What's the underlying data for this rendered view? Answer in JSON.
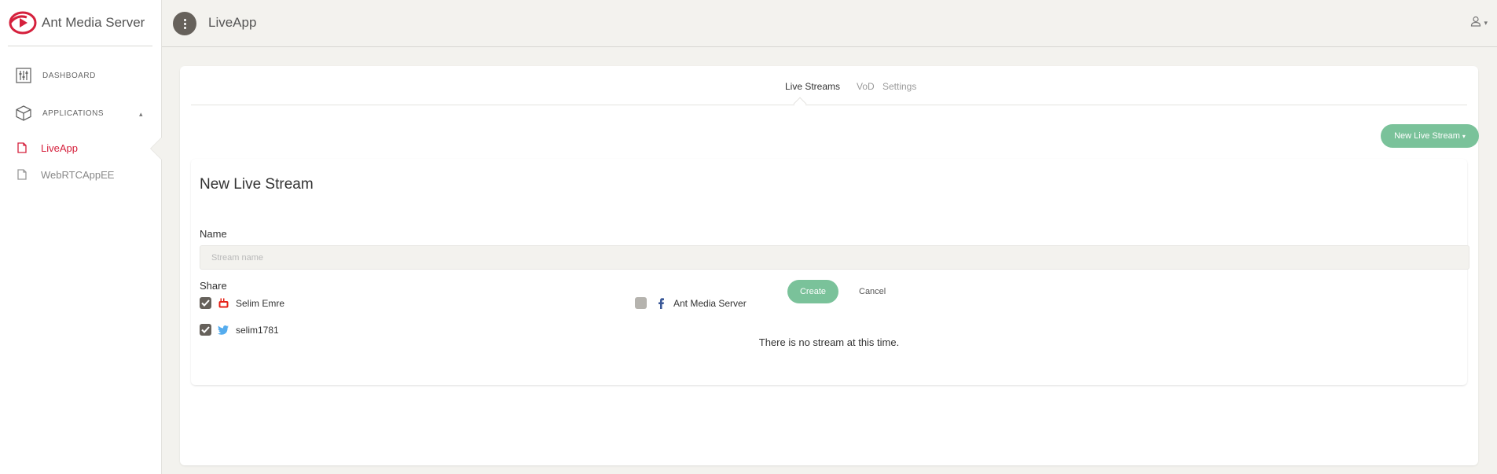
{
  "brand": {
    "name": "Ant Media Server",
    "accent": "#d5203c"
  },
  "sidebar": {
    "nav": [
      {
        "label": "DASHBOARD",
        "icon": "sliders-icon"
      },
      {
        "label": "APPLICATIONS",
        "icon": "cube-icon",
        "caret": "▴"
      }
    ],
    "apps": [
      {
        "label": "LiveApp",
        "icon": "file-icon",
        "active": true
      },
      {
        "label": "WebRTCAppEE",
        "icon": "file-icon",
        "active": false
      }
    ]
  },
  "header": {
    "title": "LiveApp",
    "user_caret": "▾"
  },
  "tabs": [
    {
      "label": "Live Streams",
      "active": true
    },
    {
      "label": "VoD",
      "active": false
    },
    {
      "label": "Settings",
      "active": false
    }
  ],
  "toolbar": {
    "new_stream_label": "New Live Stream",
    "new_stream_caret": "▾"
  },
  "form": {
    "title": "New Live Stream",
    "name_label": "Name",
    "name_value": "",
    "name_placeholder": "Stream name",
    "share_label": "Share",
    "share_targets": [
      {
        "label": "Selim Emre",
        "network": "youtube-icon",
        "checked": true
      },
      {
        "label": "Ant Media Server",
        "network": "facebook-icon",
        "checked": false
      },
      {
        "label": "selim1781",
        "network": "twitter-icon",
        "checked": true
      }
    ],
    "create_label": "Create",
    "cancel_label": "Cancel"
  },
  "empty_message": "There is no stream at this time.",
  "colors": {
    "success": "#7ac29a",
    "dark": "#66615b",
    "youtube": "#e62117",
    "facebook": "#3b5998",
    "twitter": "#55acee"
  }
}
